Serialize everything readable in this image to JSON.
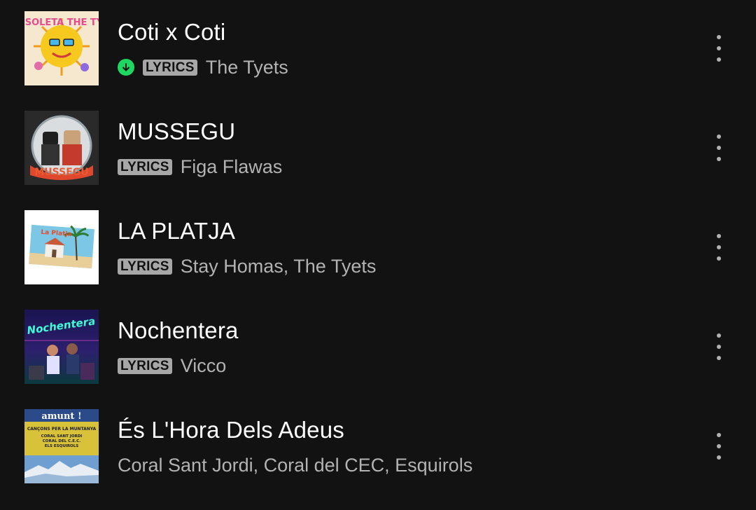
{
  "colors": {
    "background": "#121212",
    "title": "#ffffff",
    "subtitle": "#b3b3b3",
    "badge_bg": "#a7a7a7",
    "download_green": "#1ed760"
  },
  "tracks": [
    {
      "title": "Coti x Coti",
      "artist": "The Tyets",
      "downloaded": true,
      "lyrics_badge": "LYRICS",
      "art_icon": "album-art-coti-x-coti",
      "art_text": "TOP SOLETA THE TYETS"
    },
    {
      "title": "MUSSEGU",
      "artist": "Figa Flawas",
      "downloaded": false,
      "lyrics_badge": "LYRICS",
      "art_icon": "album-art-mussegu",
      "art_text": "MUSSEGU"
    },
    {
      "title": "LA PLATJA",
      "artist": "Stay Homas, The Tyets",
      "downloaded": false,
      "lyrics_badge": "LYRICS",
      "art_icon": "album-art-la-platja",
      "art_text": "La Platja"
    },
    {
      "title": "Nochentera",
      "artist": "Vicco",
      "downloaded": false,
      "lyrics_badge": "LYRICS",
      "art_icon": "album-art-nochentera",
      "art_text": "Nochentera"
    },
    {
      "title": "És L'Hora Dels Adeus",
      "artist": "Coral Sant Jordi, Coral del CEC, Esquirols",
      "downloaded": false,
      "lyrics_badge": "",
      "art_icon": "album-art-amunt",
      "art_text": "amunt! CANÇONS PER LA MUNTANYA CORAL SANT JORDI CORAL DEL C.E.C. ELS ESQUIROLS"
    }
  ]
}
